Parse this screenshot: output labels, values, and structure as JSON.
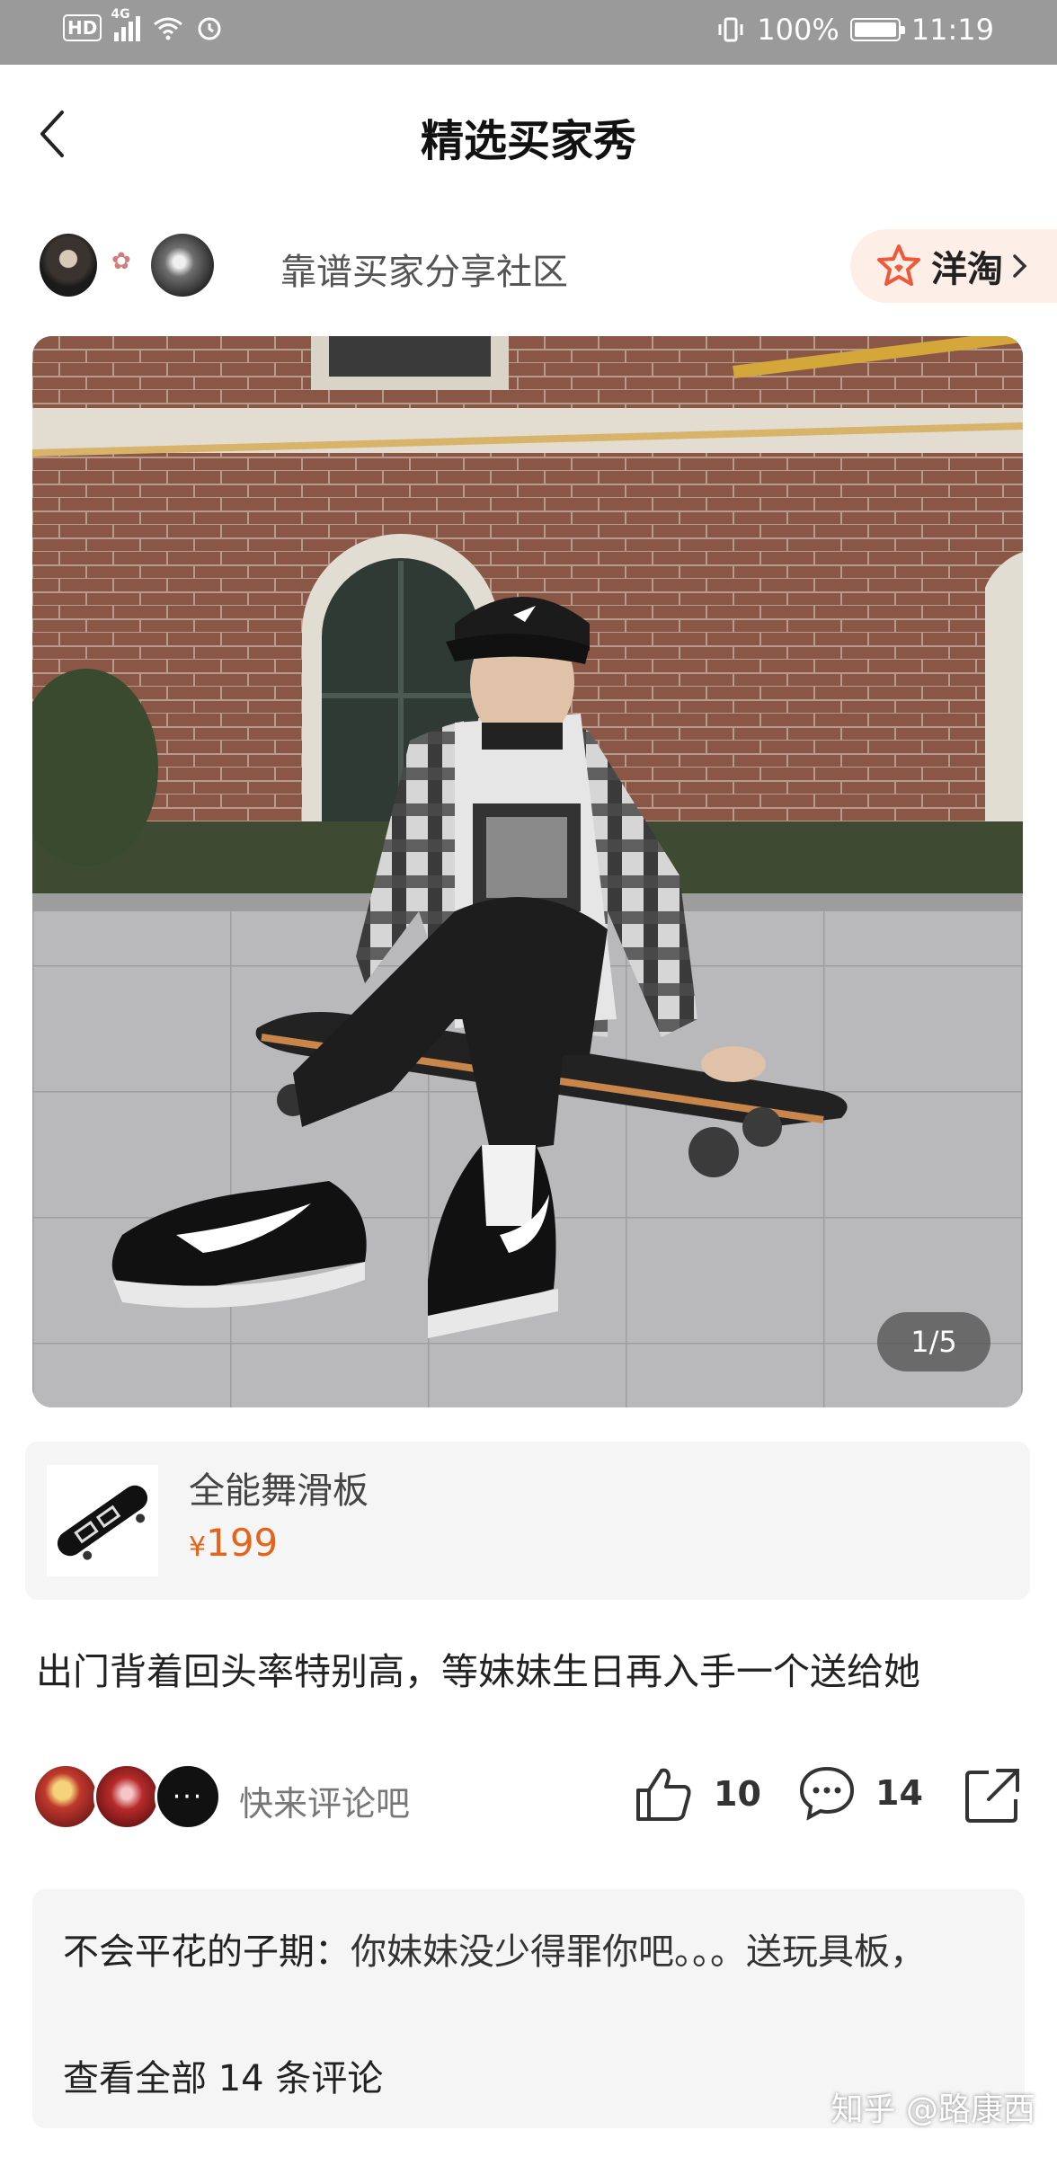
{
  "status_bar": {
    "network": "4G",
    "hd": "HD",
    "battery": "100%",
    "time": "11:19"
  },
  "header": {
    "title": "精选买家秀"
  },
  "community": {
    "label": "靠谱买家分享社区",
    "badge": "洋淘"
  },
  "photo": {
    "page_indicator": "1/5"
  },
  "product": {
    "name": "全能舞滑板",
    "currency": "¥",
    "price": "199"
  },
  "post": {
    "text": "出门背着回头率特别高，等妹妹生日再入手一个送给她"
  },
  "actions": {
    "comment_prompt": "快来评论吧",
    "like_count": "10",
    "comment_count": "14",
    "more_avatar": "···"
  },
  "comments": {
    "first_user": "不会平花的子期：",
    "first_text": "你妹妹没少得罪你吧。。。送玩具板，",
    "view_all": "查看全部 14 条评论"
  },
  "watermark": "知乎 @路康西"
}
